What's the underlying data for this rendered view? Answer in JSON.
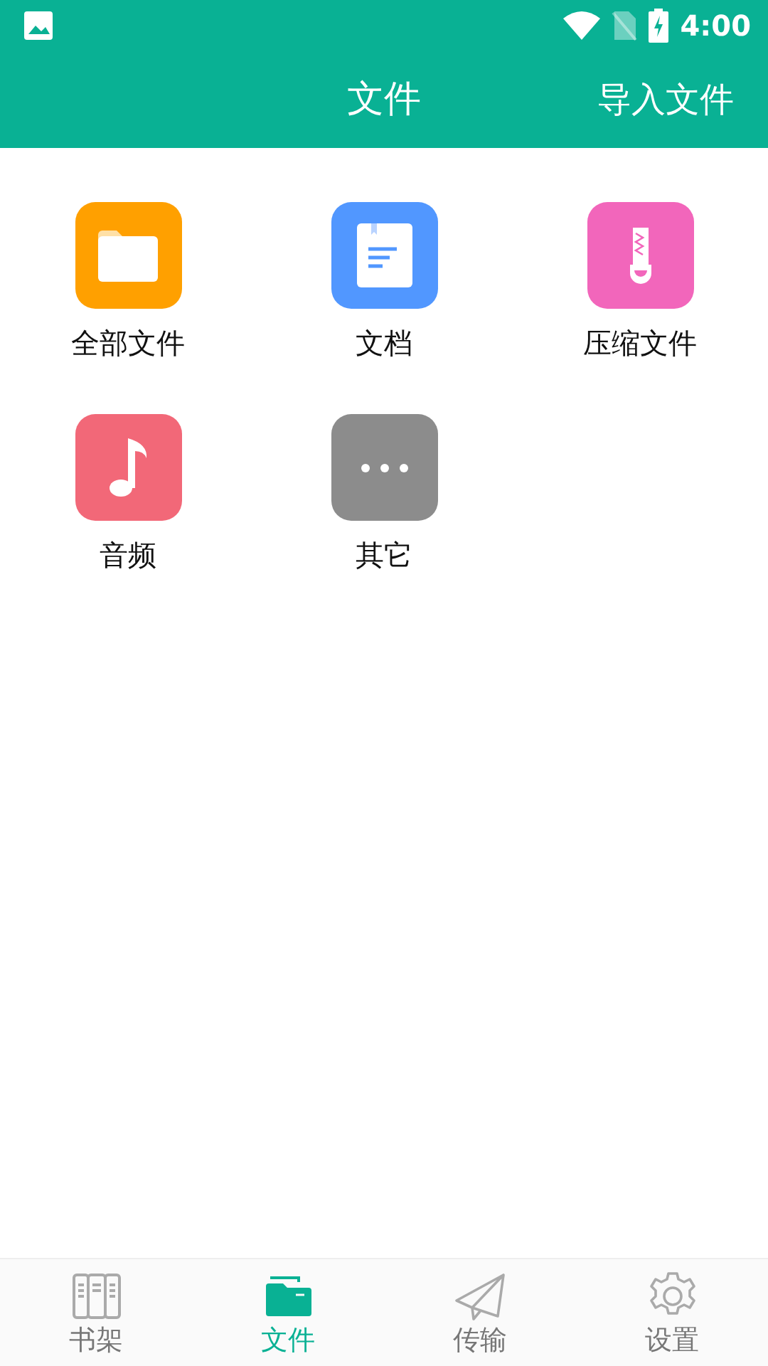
{
  "status_bar": {
    "time": "4:00"
  },
  "app_bar": {
    "title": "文件",
    "action": "导入文件"
  },
  "categories": [
    {
      "label": "全部文件",
      "kind": "folder",
      "color": "#ffa000"
    },
    {
      "label": "文档",
      "kind": "document",
      "color": "#5197ff"
    },
    {
      "label": "压缩文件",
      "kind": "zip",
      "color": "#f266bb"
    },
    {
      "label": "音频",
      "kind": "music",
      "color": "#f26878"
    },
    {
      "label": "其它",
      "kind": "more",
      "color": "#8c8c8c"
    }
  ],
  "bottom_nav": [
    {
      "label": "书架",
      "kind": "shelf",
      "selected": false
    },
    {
      "label": "文件",
      "kind": "files",
      "selected": true
    },
    {
      "label": "传输",
      "kind": "transfer",
      "selected": false
    },
    {
      "label": "设置",
      "kind": "settings",
      "selected": false
    }
  ]
}
